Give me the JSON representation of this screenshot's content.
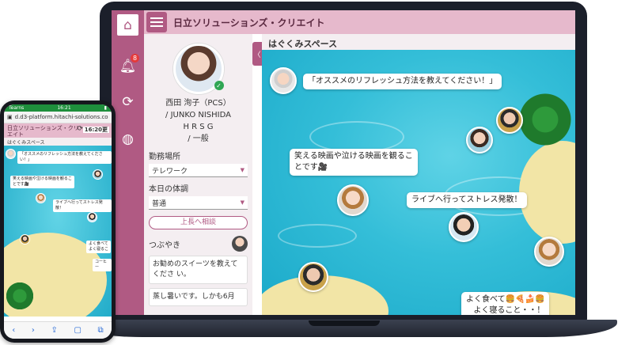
{
  "laptop_app": {
    "brand": "日立ソリューションズ・クリエイト",
    "sidebar": {
      "home_icon": "home-icon",
      "bell_icon": "bell-icon",
      "notification_count": "8",
      "sync_icon": "sync-icon",
      "globe_icon": "globe-icon"
    },
    "profile": {
      "name_line1": "西田 洵子（PCS）",
      "name_line2": "/ JUNKO NISHIDA",
      "name_line3": "H R S G",
      "name_line4": "/ 一般",
      "status_check": "✓",
      "work_place_label": "勤務場所",
      "work_place_value": "テレワーク",
      "condition_label": "本日の体調",
      "condition_value": "普通",
      "consult_button": "上長へ相談",
      "tweets_label": "つぶやき",
      "tweet1": "お勧めのスイーツを教えてくださ い。",
      "tweet2": "蒸し暑いです。しかも6月"
    },
    "space_title": "はぐくみスペース",
    "collapse_arrow": "〈",
    "bubbles": {
      "b1": "「オススメのリフレッシュ方法を教えてください！」",
      "b2_line1": "笑える映画や泣ける映画を観るこ",
      "b2_line2": "とです🎥",
      "b3": "ライブへ行ってストレス発散！",
      "b4_line1": "よく食べて🍔🍕🍰🍔",
      "b4_line2": "よく寝ること・・！"
    }
  },
  "phone_app": {
    "status_left": "Tearns",
    "status_time": "16:21",
    "url": "d.d3-platform.hitachi-solutions.co",
    "brand_line1": "日立ソリューションズ・クリ",
    "brand_line2": "エイト",
    "time_chip": "16:20更",
    "space_title": "はぐくみスペース",
    "b1": "「オススメのリフレッシュ方法を教えてください！」",
    "b2": "笑える映画や泣ける映画を観るこ",
    "b2b": "とです🎥",
    "b3": "ライブへ行ってストレス発散！",
    "b4": "よく食べて",
    "b4b": "よく寝るこ",
    "b5": "コーヒー",
    "nav": [
      "‹",
      "›",
      "⇪",
      "▢",
      "⧉"
    ]
  },
  "colors": {
    "accent": "#b05a83",
    "header_pink": "#e6b9cc",
    "ocean": "#34bed8"
  }
}
